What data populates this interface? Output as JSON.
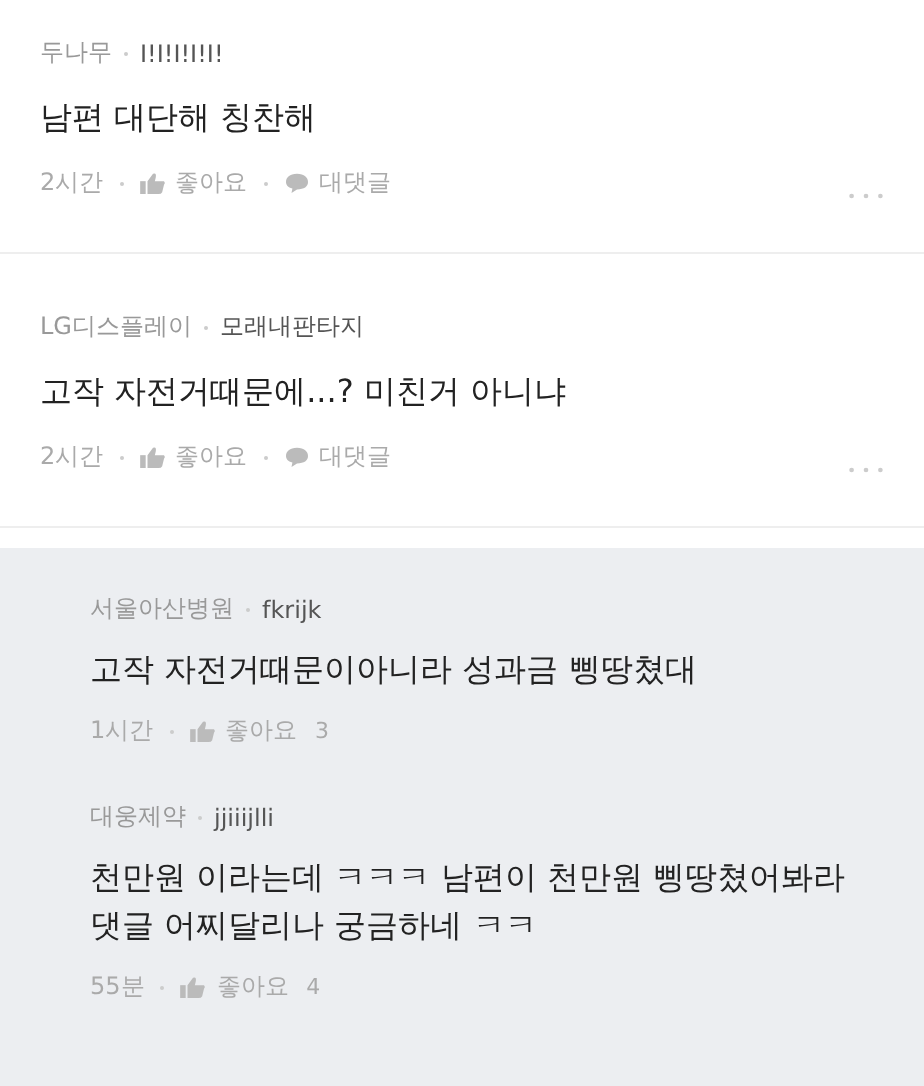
{
  "comments": [
    {
      "kind": "comment",
      "company": "두나무",
      "nickname": "I!I!I!I!I!",
      "text": "남편 대단해 칭찬해",
      "time": "2시간",
      "like_label": "좋아요",
      "reply_label": "대댓글"
    },
    {
      "kind": "comment",
      "company": "LG디스플레이",
      "nickname": "모래내판타지",
      "text": "고작 자전거때문에...? 미친거 아니냐",
      "time": "2시간",
      "like_label": "좋아요",
      "reply_label": "대댓글"
    },
    {
      "kind": "reply",
      "company": "서울아산병원",
      "nickname": "fkrijk",
      "text": "고작 자전거때문이아니라 성과금 삥땅쳤대",
      "time": "1시간",
      "like_label": "좋아요",
      "like_count": "3"
    },
    {
      "kind": "reply",
      "company": "대웅제약",
      "nickname": "jjiiijlli",
      "text": "천만원 이라는데 ㅋㅋㅋ 남편이 천만원 삥땅쳤어봐라 댓글 어찌달리나 궁금하네 ㅋㅋ",
      "time": "55분",
      "like_label": "좋아요",
      "like_count": "4"
    }
  ]
}
